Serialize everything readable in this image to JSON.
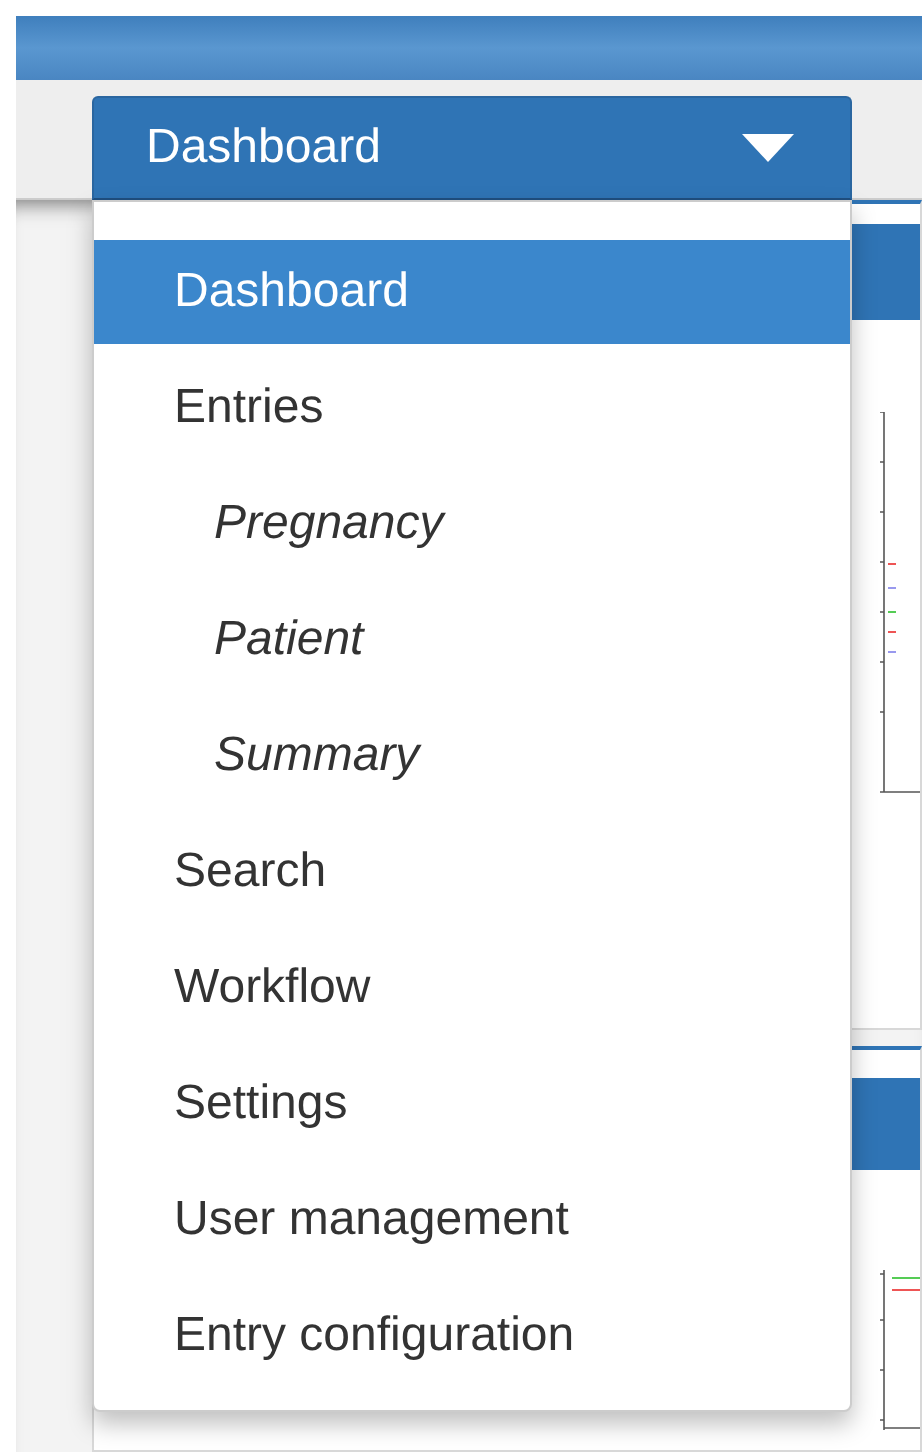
{
  "nav_dropdown": {
    "label": "Dashboard",
    "expanded": true
  },
  "menu": {
    "items": [
      {
        "label": "Dashboard",
        "selected": true
      },
      {
        "label": "Entries",
        "selected": false,
        "children": [
          {
            "label": "Pregnancy",
            "selected": false
          },
          {
            "label": "Patient",
            "selected": false
          },
          {
            "label": "Summary",
            "selected": false
          }
        ]
      },
      {
        "label": "Search",
        "selected": false
      },
      {
        "label": "Workflow",
        "selected": false
      },
      {
        "label": "Settings",
        "selected": false
      },
      {
        "label": "User management",
        "selected": false
      },
      {
        "label": "Entry configuration",
        "selected": false
      }
    ]
  }
}
